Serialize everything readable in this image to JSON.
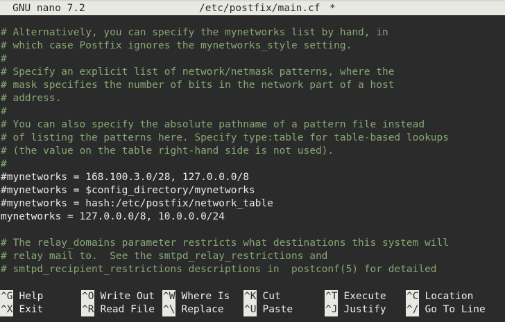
{
  "titlebar": {
    "app": "GNU nano 7.2",
    "file": "/etc/postfix/main.cf",
    "modified": "*"
  },
  "lines": [
    {
      "text": "# Alternatively, you can specify the mynetworks list by hand, in",
      "type": "comment"
    },
    {
      "text": "# which case Postfix ignores the mynetworks_style setting.",
      "type": "comment"
    },
    {
      "text": "#",
      "type": "comment"
    },
    {
      "text": "# Specify an explicit list of network/netmask patterns, where the",
      "type": "comment"
    },
    {
      "text": "# mask specifies the number of bits in the network part of a host",
      "type": "comment"
    },
    {
      "text": "# address.",
      "type": "comment"
    },
    {
      "text": "#",
      "type": "comment"
    },
    {
      "text": "# You can also specify the absolute pathname of a pattern file instead",
      "type": "comment"
    },
    {
      "text": "# of listing the patterns here. Specify type:table for table-based lookups",
      "type": "comment"
    },
    {
      "text": "# (the value on the table right-hand side is not used).",
      "type": "comment"
    },
    {
      "text": "#",
      "type": "comment"
    },
    {
      "text": "#mynetworks = 168.100.3.0/28, 127.0.0.0/8",
      "type": "code"
    },
    {
      "text": "#mynetworks = $config_directory/mynetworks",
      "type": "code"
    },
    {
      "text": "#mynetworks = hash:/etc/postfix/network_table",
      "type": "code"
    },
    {
      "text": "mynetworks = 127.0.0.0/8, 10.0.0.0/24",
      "type": "code"
    },
    {
      "text": "",
      "type": "blank"
    },
    {
      "text": "# The relay_domains parameter restricts what destinations this system will",
      "type": "comment"
    },
    {
      "text": "# relay mail to.  See the smtpd_relay_restrictions and",
      "type": "comment"
    },
    {
      "text": "# smtpd_recipient_restrictions descriptions in  postconf(5) for detailed",
      "type": "comment"
    }
  ],
  "shortcuts": [
    {
      "key": "^G",
      "label": "Help"
    },
    {
      "key": "^O",
      "label": "Write Out"
    },
    {
      "key": "^W",
      "label": "Where Is"
    },
    {
      "key": "^K",
      "label": "Cut"
    },
    {
      "key": "^T",
      "label": "Execute"
    },
    {
      "key": "^C",
      "label": "Location"
    },
    {
      "key": "^X",
      "label": "Exit"
    },
    {
      "key": "^R",
      "label": "Read File"
    },
    {
      "key": "^\\",
      "label": "Replace"
    },
    {
      "key": "^U",
      "label": "Paste"
    },
    {
      "key": "^J",
      "label": "Justify"
    },
    {
      "key": "^/",
      "label": "Go To Line"
    }
  ]
}
